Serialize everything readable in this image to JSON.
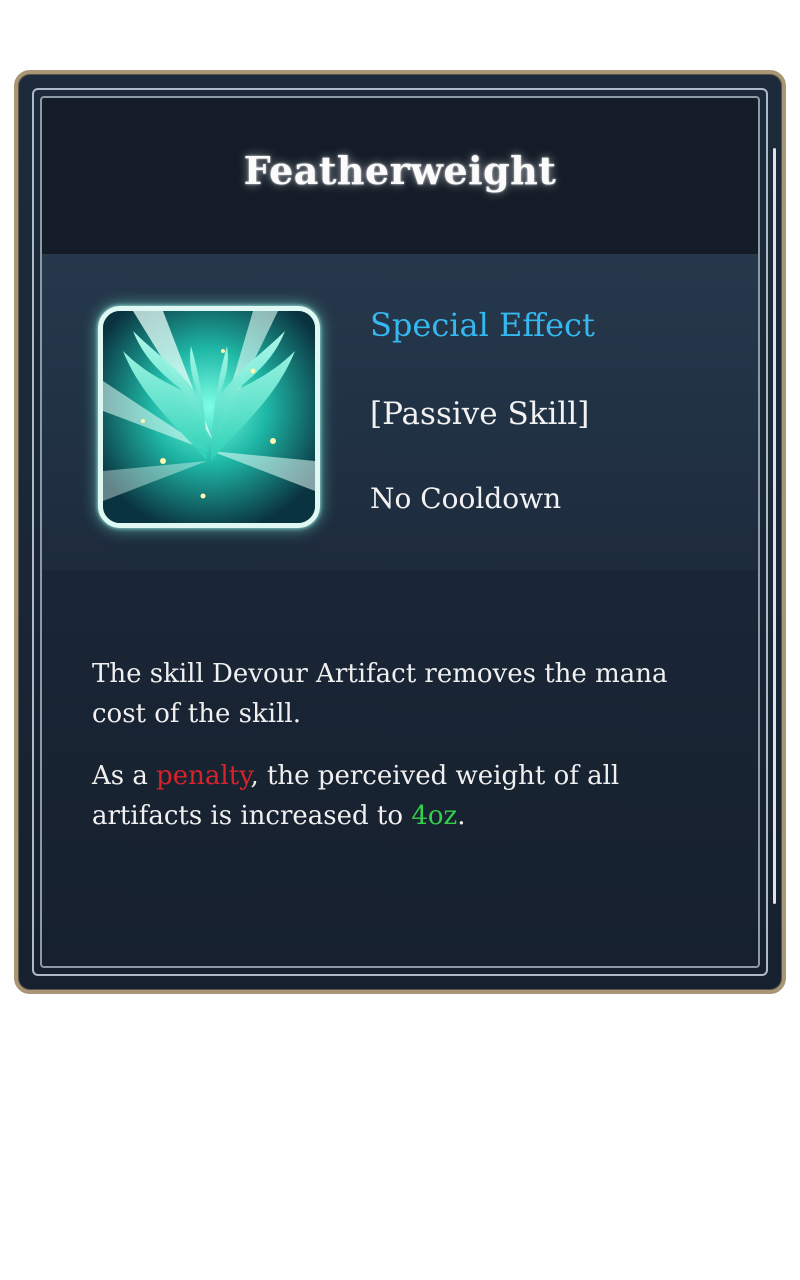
{
  "card": {
    "title": "Featherweight",
    "icon": "feather-wings-icon",
    "effect_label": "Special Effect",
    "skill_type": "[Passive Skill]",
    "cooldown": "No Cooldown",
    "description": {
      "line1": "The skill Devour Artifact removes the mana cost of the skill.",
      "p2_before": "As a ",
      "p2_penalty": "penalty",
      "p2_middle": ", the perceived weight of all artifacts is increased to ",
      "p2_weight": "4oz",
      "p2_end": "."
    }
  },
  "colors": {
    "panel_border": "#a89676",
    "panel_bg": "#1b2838",
    "effect_label": "#35b7f0",
    "penalty": "#d8232a",
    "weight": "#33d14a",
    "icon_glow": "#6fffe0"
  }
}
